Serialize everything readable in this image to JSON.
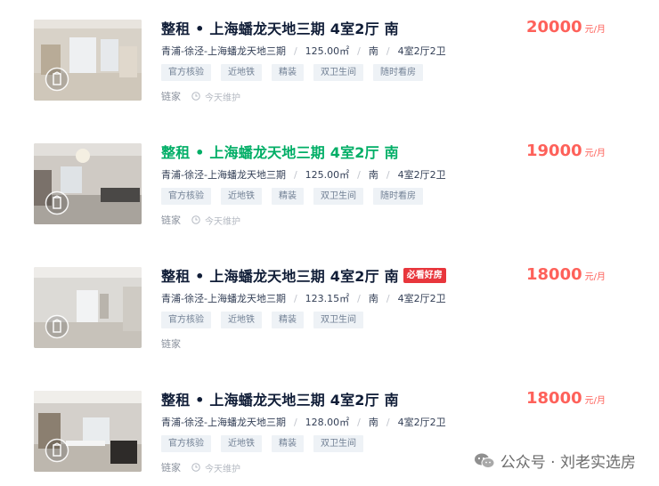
{
  "listings": [
    {
      "title": "整租 • 上海蟠龙天地三期 4室2厅 南",
      "badge": "",
      "desc": [
        "青浦-徐泾-上海蟠龙天地三期",
        "125.00㎡",
        "南",
        "4室2厅2卫"
      ],
      "tags": [
        "官方核验",
        "近地铁",
        "精装",
        "双卫生间",
        "随时看房"
      ],
      "brand": "链家",
      "maintenance": "今天维护",
      "price": "20000",
      "unit": "元/月",
      "hover": false
    },
    {
      "title": "整租 • 上海蟠龙天地三期 4室2厅 南",
      "badge": "",
      "desc": [
        "青浦-徐泾-上海蟠龙天地三期",
        "125.00㎡",
        "南",
        "4室2厅2卫"
      ],
      "tags": [
        "官方核验",
        "近地铁",
        "精装",
        "双卫生间",
        "随时看房"
      ],
      "brand": "链家",
      "maintenance": "今天维护",
      "price": "19000",
      "unit": "元/月",
      "hover": true
    },
    {
      "title": "整租 • 上海蟠龙天地三期 4室2厅 南",
      "badge": "必看好房",
      "desc": [
        "青浦-徐泾-上海蟠龙天地三期",
        "123.15㎡",
        "南",
        "4室2厅2卫"
      ],
      "tags": [
        "官方核验",
        "近地铁",
        "精装",
        "双卫生间"
      ],
      "brand": "链家",
      "maintenance": "",
      "price": "18000",
      "unit": "元/月",
      "hover": false
    },
    {
      "title": "整租 • 上海蟠龙天地三期 4室2厅 南",
      "badge": "",
      "desc": [
        "青浦-徐泾-上海蟠龙天地三期",
        "128.00㎡",
        "南",
        "4室2厅2卫"
      ],
      "tags": [
        "官方核验",
        "近地铁",
        "精装",
        "双卫生间"
      ],
      "brand": "链家",
      "maintenance": "今天维护",
      "price": "18000",
      "unit": "元/月",
      "hover": false
    }
  ],
  "watermark": "公众号 · 刘老实选房",
  "colors": {
    "price": "#fe615a",
    "title": "#101d37",
    "title_hover": "#00ae66",
    "badge": "#e8363c",
    "tag_bg": "#eef2f6"
  },
  "icons": {
    "vr": "vr-360-icon",
    "clock": "clock-icon",
    "wechat": "wechat-icon"
  }
}
